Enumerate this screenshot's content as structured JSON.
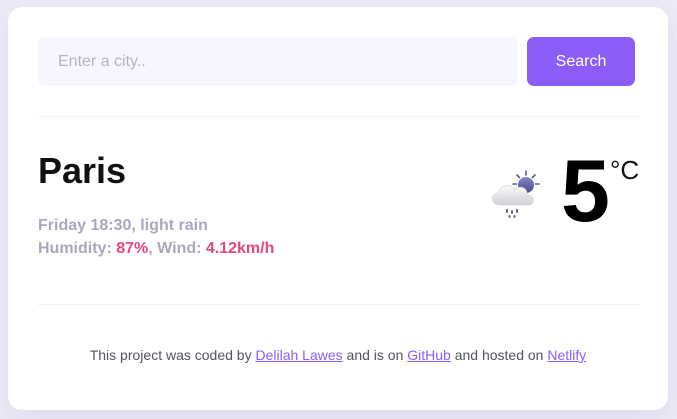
{
  "search": {
    "placeholder": "Enter a city..",
    "button_label": "Search"
  },
  "weather": {
    "city": "Paris",
    "datetime": "Friday 18:30",
    "description": "light rain",
    "humidity_label": "Humidity:",
    "humidity": "87%",
    "wind_label": "Wind:",
    "wind": "4.12km/h",
    "temperature": "5",
    "unit": "°C",
    "icon": "cloud-sun-rain-icon"
  },
  "footer": {
    "text_before": "This project was coded by",
    "author": "Delilah Lawes",
    "text_middle": "and is on",
    "repo_link": "GitHub",
    "text_after": "and hosted on",
    "host_link": "Netlify"
  },
  "colors": {
    "accent": "#8b5cf6",
    "highlight": "#e8467c",
    "muted": "#aca6bd",
    "background": "#ecebf6"
  }
}
